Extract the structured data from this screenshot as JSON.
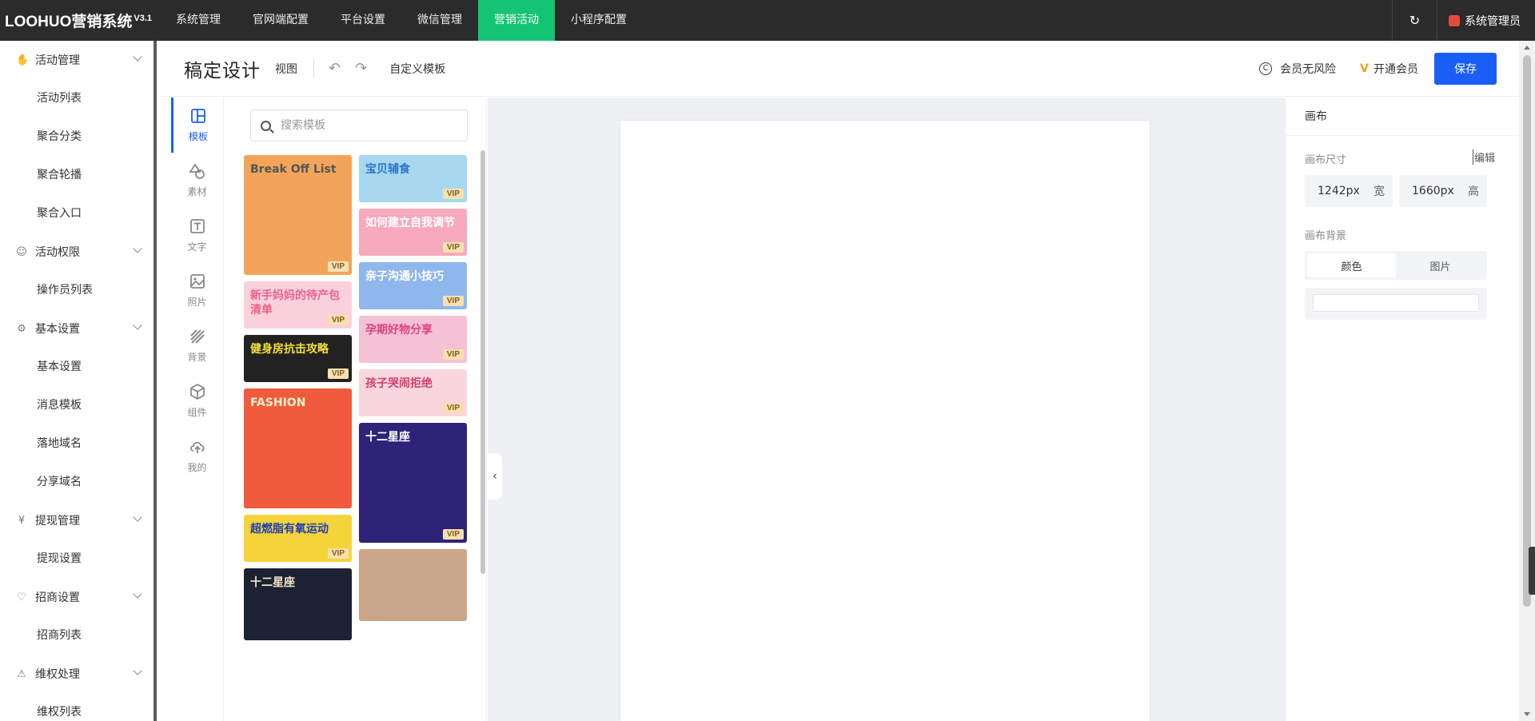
{
  "app": {
    "brand": "LOOHUO营销系统",
    "version": "V3.1"
  },
  "topnav": [
    {
      "label": "系统管理",
      "active": false
    },
    {
      "label": "官网端配置",
      "active": false
    },
    {
      "label": "平台设置",
      "active": false
    },
    {
      "label": "微信管理",
      "active": false
    },
    {
      "label": "营销活动",
      "active": true
    },
    {
      "label": "小程序配置",
      "active": false
    }
  ],
  "user": {
    "name": "系统管理员"
  },
  "sidebar": [
    {
      "group": "活动管理",
      "icon": "hand-icon",
      "items": [
        "活动列表",
        "聚合分类",
        "聚合轮播",
        "聚合入口"
      ]
    },
    {
      "group": "活动权限",
      "icon": "user-icon",
      "items": [
        "操作员列表"
      ]
    },
    {
      "group": "基本设置",
      "icon": "gear-icon",
      "items": [
        "基本设置",
        "消息模板",
        "落地域名",
        "分享域名"
      ]
    },
    {
      "group": "提现管理",
      "icon": "money-icon",
      "items": [
        "提现设置"
      ]
    },
    {
      "group": "招商设置",
      "icon": "handshake-icon",
      "items": [
        "招商列表"
      ]
    },
    {
      "group": "维权处理",
      "icon": "warning-icon",
      "items": [
        "维权列表"
      ]
    }
  ],
  "editor": {
    "title": "稿定设计",
    "view_label": "视图",
    "custom_template_label": "自定义模板",
    "member_risk_label": "会员无风险",
    "open_member_label": "开通会员",
    "save_label": "保存"
  },
  "tools": [
    {
      "label": "模板",
      "icon": "template-icon",
      "active": true
    },
    {
      "label": "素材",
      "icon": "shapes-icon",
      "active": false
    },
    {
      "label": "文字",
      "icon": "text-icon",
      "active": false
    },
    {
      "label": "照片",
      "icon": "photo-icon",
      "active": false
    },
    {
      "label": "背景",
      "icon": "background-icon",
      "active": false
    },
    {
      "label": "组件",
      "icon": "cube-icon",
      "active": false
    },
    {
      "label": "我的",
      "icon": "cloud-upload-icon",
      "active": false
    }
  ],
  "search": {
    "placeholder": "搜索模板"
  },
  "templates": {
    "col1": [
      {
        "text": "Break Off List",
        "bg": "#f2a55a",
        "h": 150,
        "color": "#555",
        "vip": "VIP"
      },
      {
        "text": "新手妈妈的待产包清单",
        "bg": "#fbd0dd",
        "h": 59,
        "color": "#e8648a",
        "vip": "VIP"
      },
      {
        "text": "健身房抗击攻略",
        "bg": "#222222",
        "h": 59,
        "color": "#f2e03a",
        "vip": "VIP"
      },
      {
        "text": "FASHION",
        "bg": "#ef5b3c",
        "h": 150,
        "color": "#fff2cc",
        "vip": ""
      },
      {
        "text": "超燃脂有氧运动",
        "bg": "#f5d43a",
        "h": 59,
        "color": "#1b3fb8",
        "vip": "VIP"
      },
      {
        "text": "十二星座",
        "bg": "#1a2233",
        "h": 90,
        "color": "#f5e6c4",
        "vip": ""
      }
    ],
    "col2": [
      {
        "text": "宝贝辅食",
        "bg": "#a8d8f0",
        "h": 59,
        "color": "#2b73c9",
        "vip": "VIP"
      },
      {
        "text": "如何建立自我调节",
        "bg": "#f7a9be",
        "h": 59,
        "color": "#fff",
        "vip": "VIP"
      },
      {
        "text": "亲子沟通小技巧",
        "bg": "#8fb7ee",
        "h": 59,
        "color": "#fff",
        "vip": "VIP"
      },
      {
        "text": "孕期好物分享",
        "bg": "#f4c2d4",
        "h": 59,
        "color": "#e0427a",
        "vip": "VIP"
      },
      {
        "text": "孩子哭闹拒绝",
        "bg": "#f8d6de",
        "h": 59,
        "color": "#d2406f",
        "vip": "VIP"
      },
      {
        "text": "十二星座",
        "bg": "#2e2378",
        "h": 150,
        "color": "#fff",
        "vip": "VIP"
      },
      {
        "text": "",
        "bg": "#c9a68a",
        "h": 90,
        "color": "#fff",
        "vip": ""
      }
    ]
  },
  "props": {
    "title": "画布",
    "size_label": "画布尺寸",
    "edit_label": "编辑",
    "width_value": "1242px",
    "width_unit": "宽",
    "height_value": "1660px",
    "height_unit": "高",
    "bg_label": "画布背景",
    "tab_color": "颜色",
    "tab_image": "图片",
    "bg_color": "#ffffff"
  },
  "colors": {
    "topbar": "#2b2b2b",
    "accent_green": "#14c474",
    "primary_blue": "#1a5ef5",
    "stage_bg": "#eef0f4"
  }
}
